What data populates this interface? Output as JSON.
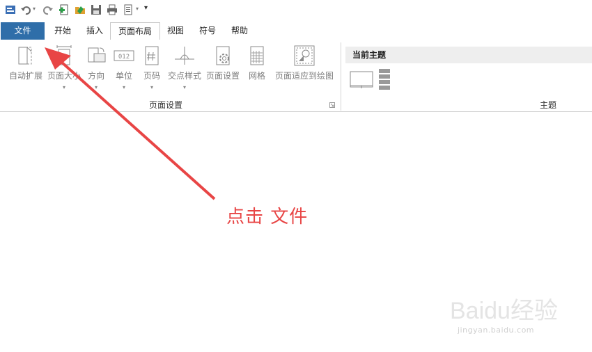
{
  "tabs": [
    {
      "label": "文件"
    },
    {
      "label": "开始"
    },
    {
      "label": "插入"
    },
    {
      "label": "页面布局"
    },
    {
      "label": "视图"
    },
    {
      "label": "符号"
    },
    {
      "label": "帮助"
    }
  ],
  "ribbon": {
    "page_setup": {
      "buttons": [
        {
          "label": "自动扩展"
        },
        {
          "label": "页面大小"
        },
        {
          "label": "方向"
        },
        {
          "label": "单位"
        },
        {
          "label": "页码"
        },
        {
          "label": "交点样式"
        },
        {
          "label": "页面设置"
        },
        {
          "label": "网格"
        },
        {
          "label": "页面适应到绘图"
        }
      ],
      "unit_icon_text": "012",
      "group_label": "页面设置"
    },
    "theme": {
      "current_label": "当前主题",
      "group_label": "主题"
    }
  },
  "annotation": {
    "text": "点击  文件"
  },
  "watermark": {
    "brand": "Baidu经验",
    "url": "jingyan.baidu.com"
  },
  "colors": {
    "file_tab": "#2f6ea9",
    "annotation": "#e84545"
  }
}
